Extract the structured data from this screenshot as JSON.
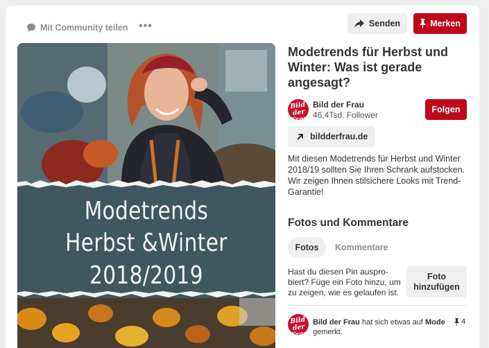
{
  "toolbar": {
    "share_label": "Mit Community teilen",
    "more_label": "•••",
    "send_label": "Senden",
    "save_label": "Merken"
  },
  "pin": {
    "image_text": [
      "Modetrends",
      "Herbst &Winter",
      "2018/2019"
    ],
    "title": "Modetrends für Herbst und Winter: Was ist gerade angesagt?",
    "author": {
      "avatar_text_1": "Bild",
      "avatar_text_2": "der",
      "avatar_text_3": "Frau",
      "name": "Bild der Frau",
      "followers": "46,4Tsd. Follower",
      "follow_label": "Folgen"
    },
    "link_label": "bildderfrau.de",
    "description": "Mit diesen Modetrends für Herbst und Winter 2018/19 sollten Sie Ihren Schrank aufstocken. Wir zeigen Ihnen stilsichere Looks mit Trend-Garantie!"
  },
  "comments": {
    "section_title": "Fotos und Kommentare",
    "tab_photos": "Fotos",
    "tab_comments": "Kommentare",
    "tried_prompt": "Hast du diesen Pin auspro-biert? Füge ein Foto hinzu, um zu zeigen, wie es gelaufen ist.",
    "add_photo_label": "Foto hinzufügen"
  },
  "activity": {
    "user": "Bild der Frau",
    "text_mid": " hat sich etwas auf ",
    "board": "Mode",
    "text_end": " gemerkt.",
    "pin_count": "4"
  },
  "colors": {
    "brand_red": "#bd081c",
    "button_gray": "#efefef",
    "banner_teal": "#3f5860"
  }
}
